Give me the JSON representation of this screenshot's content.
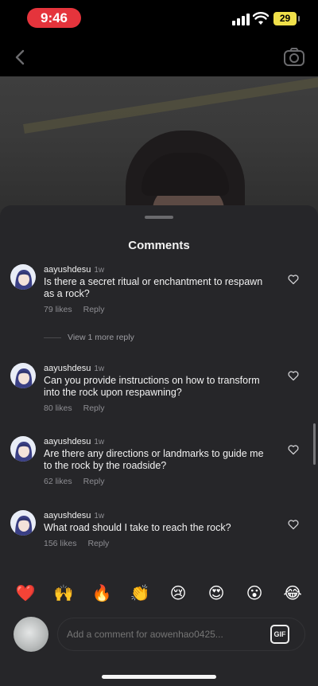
{
  "status_bar": {
    "time": "9:46",
    "battery_level": "29"
  },
  "header": {
    "back_icon": "chevron-left-icon",
    "camera_icon": "camera-icon"
  },
  "sheet": {
    "title": "Comments"
  },
  "comments": [
    {
      "username": "aayushdesu",
      "age": "1w",
      "text": "Is there a secret ritual or enchantment to respawn as a rock?",
      "likes": "79 likes",
      "reply_label": "Reply"
    },
    {
      "username": "aayushdesu",
      "age": "1w",
      "text": "Can you provide instructions on how to transform into the rock upon respawning?",
      "likes": "80 likes",
      "reply_label": "Reply"
    },
    {
      "username": "aayushdesu",
      "age": "1w",
      "text": "Are there any directions or landmarks to guide me to the rock by the roadside?",
      "likes": "62 likes",
      "reply_label": "Reply"
    },
    {
      "username": "aayushdesu",
      "age": "1w",
      "text": "What road should I take to reach the rock?",
      "likes": "156 likes",
      "reply_label": "Reply"
    }
  ],
  "view_more_replies": "View 1 more reply",
  "emoji_reactions": [
    "❤️",
    "🙌",
    "🔥",
    "👏",
    "😢",
    "😍",
    "😮",
    "😂"
  ],
  "composer": {
    "placeholder": "Add a comment for aowenhao0425...",
    "gif_label": "GIF"
  },
  "colors": {
    "time_pill": "#e5343c",
    "battery": "#f0e04a",
    "sheet_background": "#262629"
  }
}
